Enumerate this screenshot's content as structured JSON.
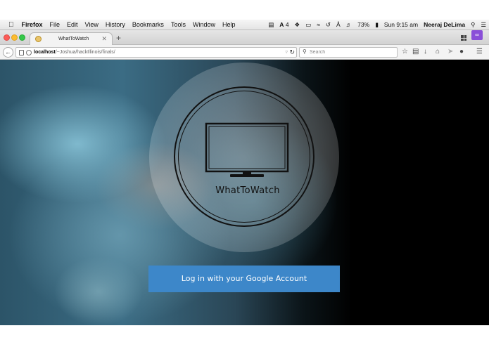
{
  "menubar": {
    "app": "Firefox",
    "items": [
      "File",
      "Edit",
      "View",
      "History",
      "Bookmarks",
      "Tools",
      "Window",
      "Help"
    ],
    "status": {
      "adobe_count": "4",
      "battery": "73%",
      "clock": "Sun 9:15 am",
      "user": "Neeraj DeLima"
    }
  },
  "browser": {
    "tab": {
      "title": "WhatToWatch"
    },
    "url": {
      "host": "localhost",
      "path": "/~Joshua/hackIllinois/finals/"
    },
    "search": {
      "placeholder": "Search"
    }
  },
  "page": {
    "brand": "WhatToWatch",
    "login_button": "Log in with your Google Account"
  },
  "colors": {
    "login_button": "#3d87c9",
    "private_mask": "#8a4fd8"
  }
}
